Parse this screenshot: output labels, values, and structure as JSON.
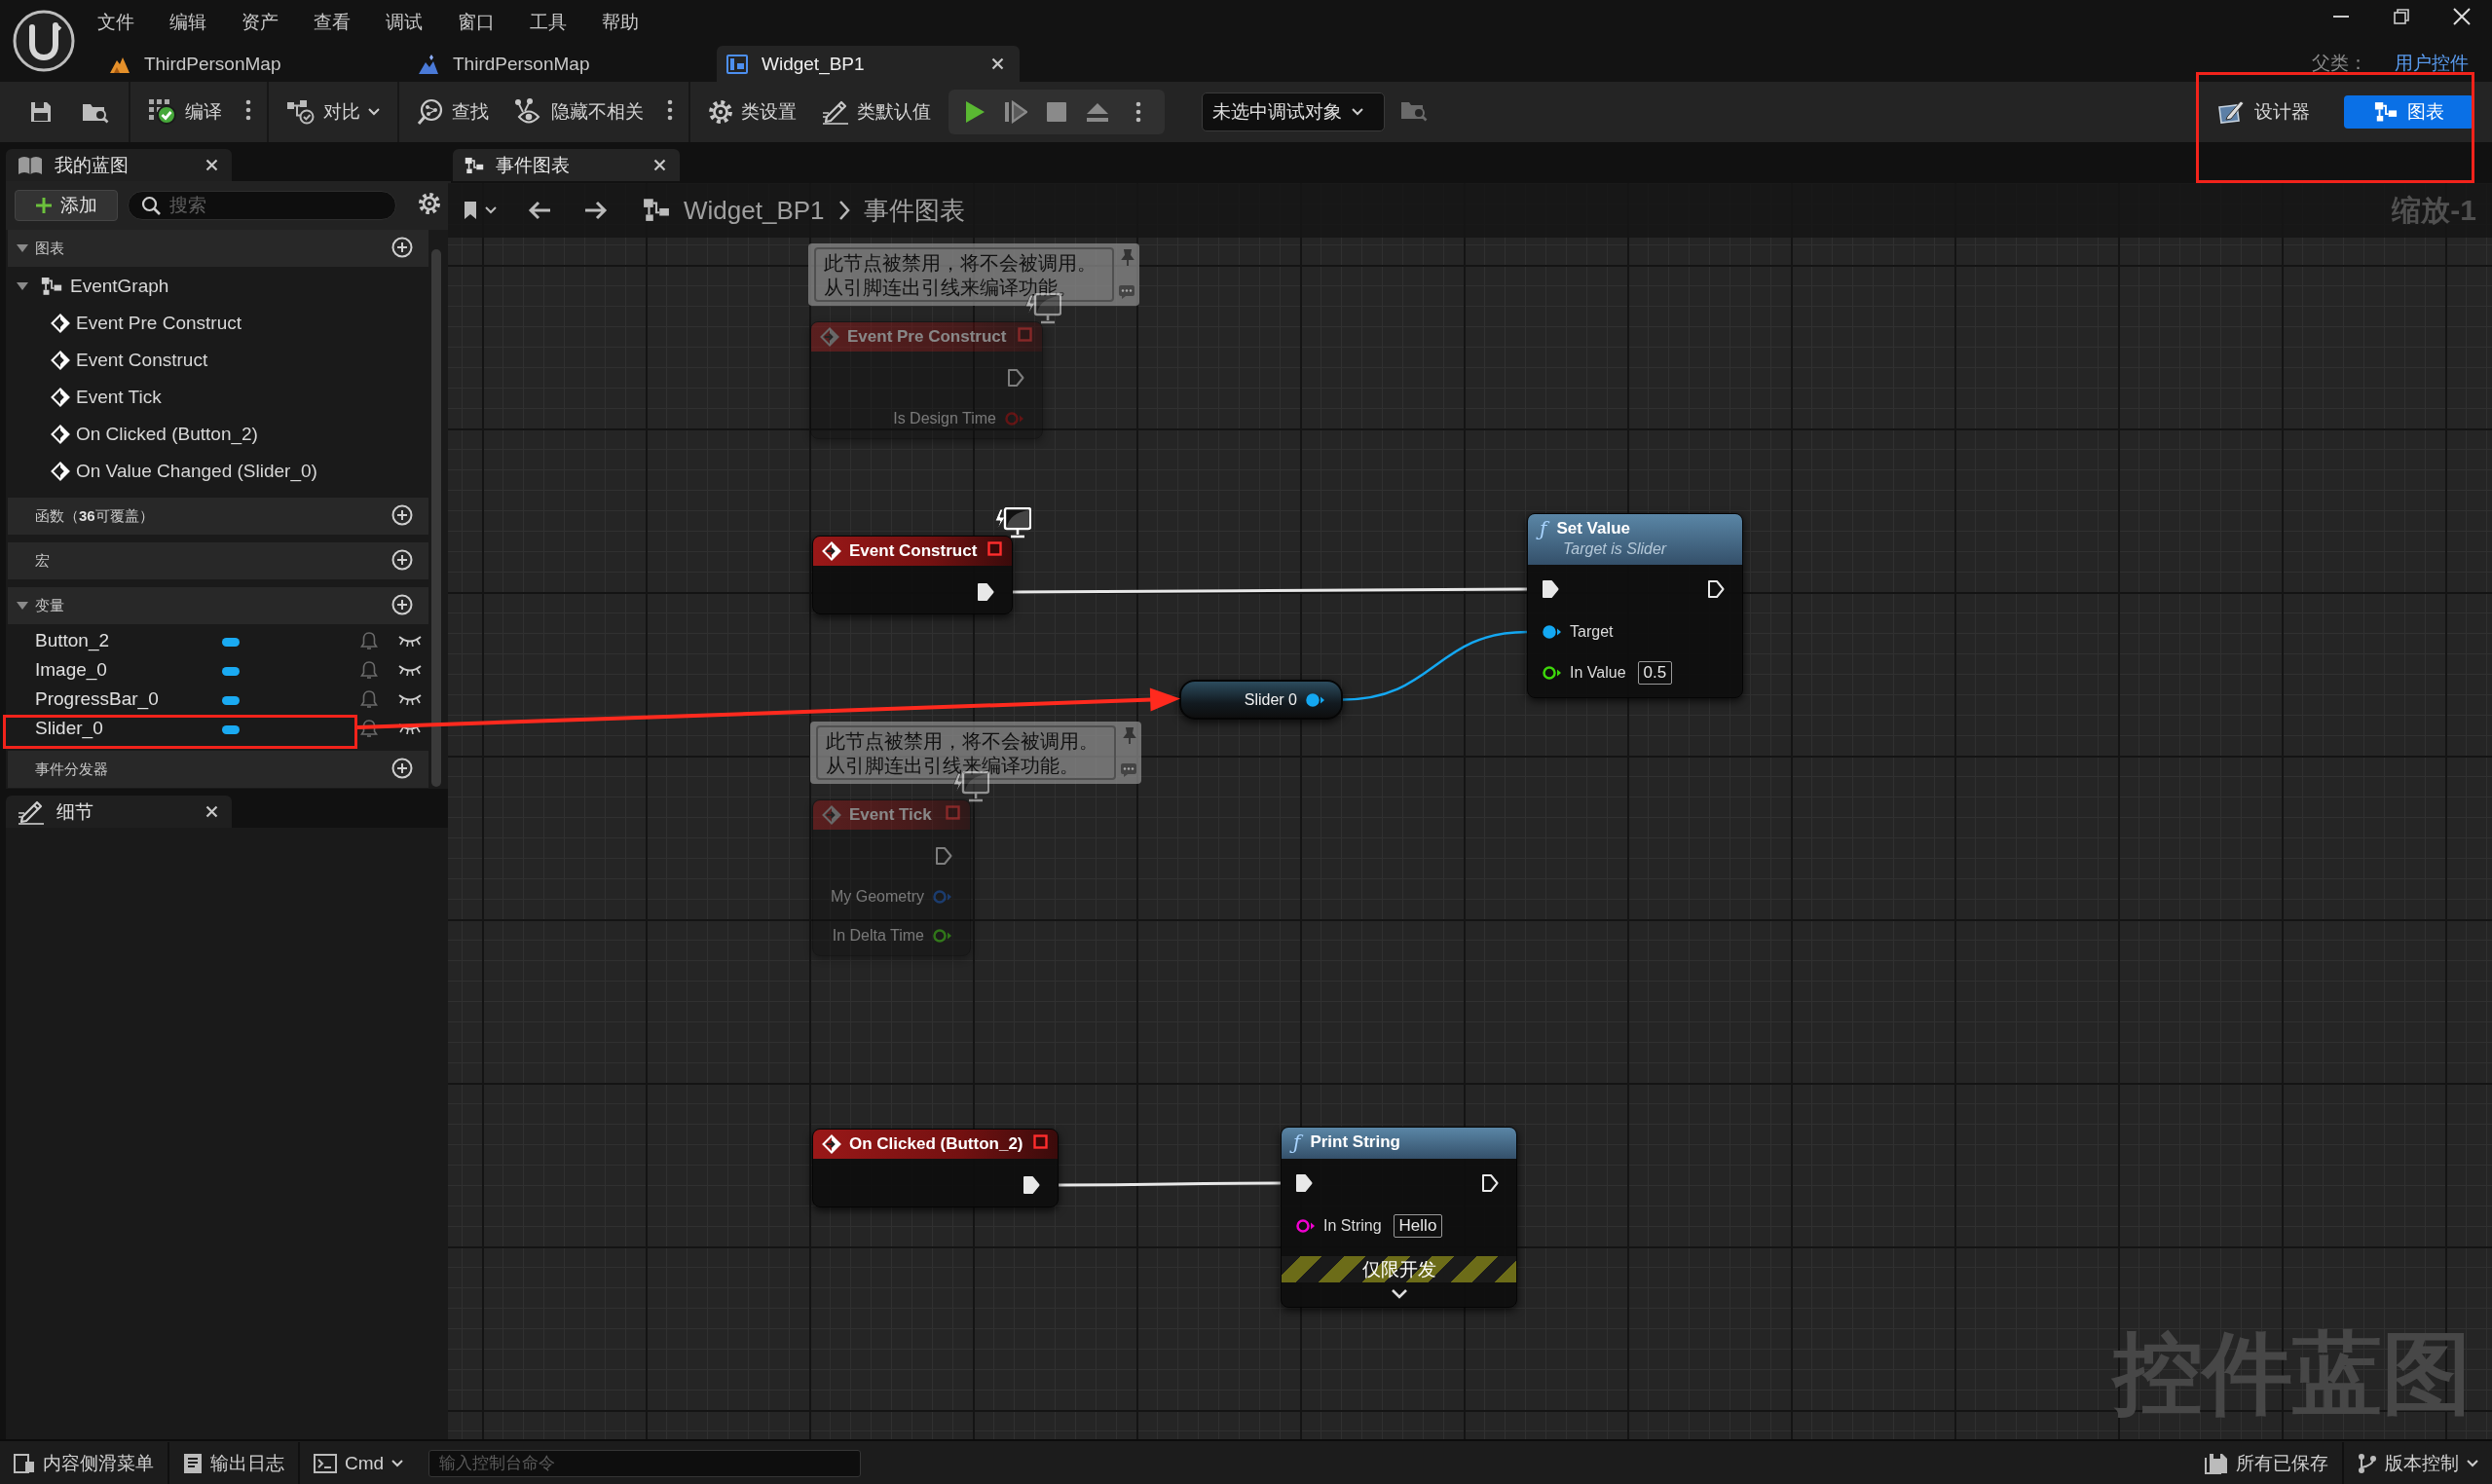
{
  "title_bar": {
    "menu": [
      "文件",
      "编辑",
      "资产",
      "查看",
      "调试",
      "窗口",
      "工具",
      "帮助"
    ],
    "tabs": [
      {
        "kind": "level",
        "label": "ThirdPersonMap",
        "selected": false
      },
      {
        "kind": "world",
        "label": "ThirdPersonMap",
        "selected": false
      },
      {
        "kind": "widget",
        "label": "Widget_BP1",
        "selected": true
      }
    ],
    "parent_class": {
      "label": "父类：",
      "value": "用户控件"
    }
  },
  "toolbar": {
    "groups": [
      [
        {
          "kind": "save"
        },
        {
          "kind": "browse"
        }
      ],
      [
        {
          "kind": "compile",
          "label": "编译",
          "more": true
        }
      ],
      [
        {
          "kind": "diff",
          "label": "对比",
          "dropdown": true
        }
      ],
      [
        {
          "kind": "find",
          "label": "查找"
        },
        {
          "kind": "hide",
          "label": "隐藏不相关",
          "more": true
        }
      ],
      [
        {
          "kind": "class_settings",
          "label": "类设置"
        },
        {
          "kind": "class_defaults",
          "label": "类默认值"
        }
      ]
    ],
    "play_controls": [
      {
        "kind": "play"
      },
      {
        "kind": "advance"
      },
      {
        "kind": "stop"
      },
      {
        "kind": "eject"
      }
    ],
    "debug_filter": "未选中调试对象",
    "modes": [
      {
        "kind": "designer",
        "label": "设计器",
        "selected": false
      },
      {
        "kind": "graph",
        "label": "图表",
        "selected": true
      }
    ]
  },
  "my_blueprint": {
    "title": "我的蓝图",
    "add_label": "添加",
    "search_placeholder": "搜索",
    "sections": [
      {
        "title": "图表",
        "expanded": true,
        "items": [
          {
            "kind": "graph",
            "label": "EventGraph",
            "expanded": true,
            "children": [
              {
                "kind": "event",
                "label": "Event Pre Construct"
              },
              {
                "kind": "event",
                "label": "Event Construct"
              },
              {
                "kind": "event",
                "label": "Event Tick"
              },
              {
                "kind": "event",
                "label": "On Clicked (Button_2)"
              },
              {
                "kind": "event",
                "label": "On Value Changed (Slider_0)"
              }
            ]
          }
        ]
      },
      {
        "title": "函数（**36**可覆盖）"
      },
      {
        "title": "宏"
      },
      {
        "title": "变量",
        "expanded": true,
        "items": [
          {
            "kind": "variable",
            "label": "Button_2"
          },
          {
            "kind": "variable",
            "label": "Image_0"
          },
          {
            "kind": "variable",
            "label": "ProgressBar_0"
          },
          {
            "kind": "variable",
            "label": "Slider_0"
          }
        ]
      },
      {
        "title": "事件分发器"
      }
    ]
  },
  "details": {
    "title": "细节"
  },
  "graph": {
    "tab": "事件图表",
    "breadcrumb": [
      "Widget_BP1",
      "事件图表"
    ],
    "zoom": "缩放-1",
    "graph_type": "控件蓝图",
    "nodes": [
      {
        "kind": "event",
        "title": "Event Pre Construct",
        "disabled": true,
        "badge": true,
        "comment": "此节点被禁用，将不会被调用。从引脚连出引线来编译功能。",
        "outputs": [
          {
            "kind": "exec",
            "connected": false
          },
          {
            "kind": "bool",
            "label": "Is Design Time",
            "connected": false
          }
        ]
      },
      {
        "kind": "event",
        "title": "Event Construct",
        "disabled": false,
        "badge": true,
        "outputs": [
          {
            "kind": "exec",
            "connected": true
          }
        ]
      },
      {
        "kind": "function",
        "icon": "ƒ",
        "title": "Set Value",
        "subtitle": "Target is Slider",
        "inputs": [
          {
            "kind": "exec",
            "connected": true
          },
          {
            "kind": "object",
            "label": "Target",
            "connected": true
          },
          {
            "kind": "float",
            "label": "In Value",
            "value": "0.5",
            "connected": false
          }
        ],
        "outputs": [
          {
            "kind": "exec",
            "connected": false
          }
        ]
      },
      {
        "kind": "variable",
        "title": "Slider 0",
        "outputs": [
          {
            "kind": "object",
            "connected": true
          }
        ]
      },
      {
        "kind": "event",
        "title": "Event Tick",
        "disabled": true,
        "badge": true,
        "comment": "此节点被禁用，将不会被调用。从引脚连出引线来编译功能。",
        "outputs": [
          {
            "kind": "exec",
            "connected": false
          },
          {
            "kind": "struct",
            "label": "My Geometry",
            "connected": false
          },
          {
            "kind": "float",
            "label": "In Delta Time",
            "connected": false
          }
        ]
      },
      {
        "kind": "event",
        "title": "On Clicked (Button_2)",
        "disabled": false,
        "badge": false,
        "outputs": [
          {
            "kind": "exec",
            "connected": true
          }
        ]
      },
      {
        "kind": "function",
        "icon": "ƒ",
        "title": "Print String",
        "dev_only": "仅限开发",
        "inputs": [
          {
            "kind": "exec",
            "connected": true
          },
          {
            "kind": "string",
            "label": "In String",
            "value": "Hello",
            "connected": false
          }
        ],
        "outputs": [
          {
            "kind": "exec",
            "connected": false
          }
        ]
      }
    ],
    "wires": [
      {
        "kind": "exec"
      },
      {
        "kind": "object"
      },
      {
        "kind": "exec"
      }
    ]
  },
  "status_bar": {
    "left": [
      {
        "kind": "content_drawer",
        "label": "内容侧滑菜单"
      },
      {
        "kind": "output_log",
        "label": "输出日志"
      },
      {
        "kind": "cmd",
        "label": "Cmd",
        "dropdown": true
      }
    ],
    "console_placeholder": "输入控制台命令",
    "right": [
      {
        "kind": "saved",
        "label": "所有已保存"
      },
      {
        "kind": "source_control",
        "label": "版本控制",
        "dropdown": true
      }
    ]
  },
  "annotations": [
    {
      "kind": "box"
    },
    {
      "kind": "box"
    },
    {
      "kind": "arrow"
    }
  ]
}
